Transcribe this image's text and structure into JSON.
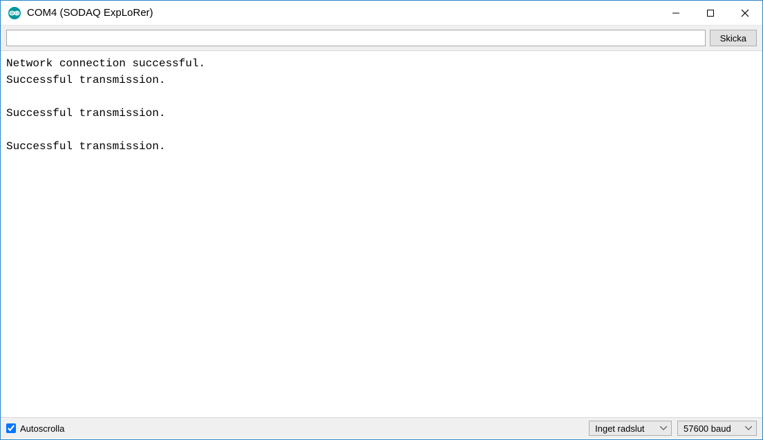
{
  "window": {
    "title": "COM4 (SODAQ ExpLoRer)"
  },
  "input": {
    "value": "",
    "placeholder": ""
  },
  "buttons": {
    "send": "Skicka"
  },
  "output_lines": "Network connection successful.\nSuccessful transmission.\n\nSuccessful transmission.\n\nSuccessful transmission.",
  "footer": {
    "autoscroll_label": "Autoscrolla",
    "autoscroll_checked": true,
    "line_ending_selected": "Inget radslut",
    "baud_selected": "57600 baud"
  }
}
